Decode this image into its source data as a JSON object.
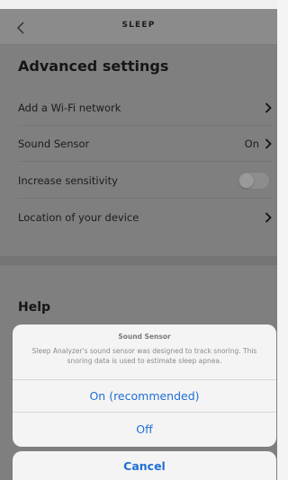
{
  "nav": {
    "title": "SLEEP"
  },
  "settings": {
    "title": "Advanced settings",
    "rows": [
      {
        "label": "Add a Wi-Fi network"
      },
      {
        "label": "Sound Sensor",
        "value": "On"
      },
      {
        "label": "Increase sensitivity",
        "toggle_on": false
      },
      {
        "label": "Location of your device"
      }
    ]
  },
  "help": {
    "title": "Help"
  },
  "action_sheet": {
    "title": "Sound Sensor",
    "message": "Sleep Analyzer's sound sensor was designed to track snoring. This snoring data is used to estimate sleep apnea.",
    "options": [
      "On (recommended)",
      "Off"
    ],
    "cancel_label": "Cancel",
    "accent_color": "#1f6fd6"
  },
  "icons": {
    "back": "chevron-left-icon",
    "row_arrow": "chevron-right-icon"
  }
}
